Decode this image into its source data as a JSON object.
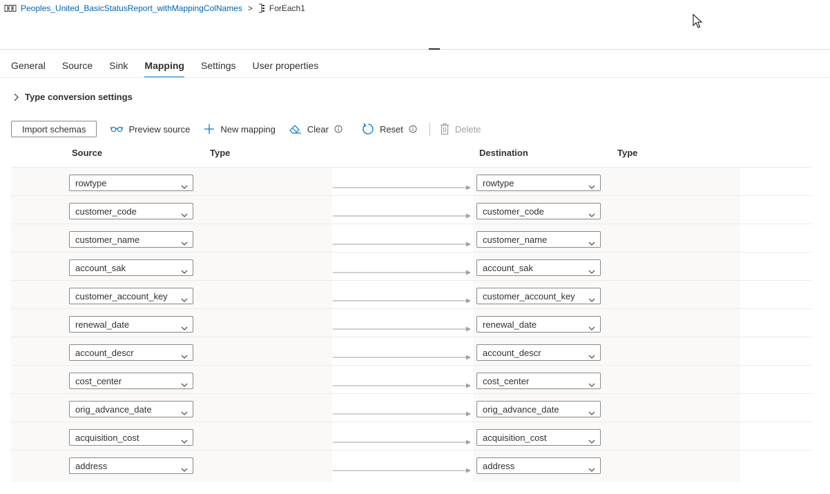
{
  "breadcrumb": {
    "pipeline": "Peoples_United_BasicStatusReport_withMappingColNames",
    "separator": ">",
    "activity": "ForEach1"
  },
  "tabs": [
    {
      "label": "General"
    },
    {
      "label": "Source"
    },
    {
      "label": "Sink"
    },
    {
      "label": "Mapping",
      "active": true
    },
    {
      "label": "Settings"
    },
    {
      "label": "User properties"
    }
  ],
  "type_conversion": {
    "label": "Type conversion settings"
  },
  "toolbar": {
    "import_schemas": "Import schemas",
    "preview_source": "Preview source",
    "new_mapping": "New mapping",
    "clear": "Clear",
    "reset": "Reset",
    "delete": "Delete"
  },
  "table": {
    "headers": {
      "source": "Source",
      "source_type": "Type",
      "destination": "Destination",
      "destination_type": "Type"
    },
    "rows": [
      {
        "source": "rowtype",
        "destination": "rowtype"
      },
      {
        "source": "customer_code",
        "destination": "customer_code"
      },
      {
        "source": "customer_name",
        "destination": "customer_name"
      },
      {
        "source": "account_sak",
        "destination": "account_sak"
      },
      {
        "source": "customer_account_key",
        "destination": "customer_account_key"
      },
      {
        "source": "renewal_date",
        "destination": "renewal_date"
      },
      {
        "source": "account_descr",
        "destination": "account_descr"
      },
      {
        "source": "cost_center",
        "destination": "cost_center"
      },
      {
        "source": "orig_advance_date",
        "destination": "orig_advance_date"
      },
      {
        "source": "acquisition_cost",
        "destination": "acquisition_cost"
      },
      {
        "source": "address",
        "destination": "address"
      }
    ]
  },
  "colors": {
    "accent": "#0078d4",
    "link": "#0062ad",
    "text": "#323130",
    "disabled": "#a19f9d",
    "border": "#8a8886"
  }
}
